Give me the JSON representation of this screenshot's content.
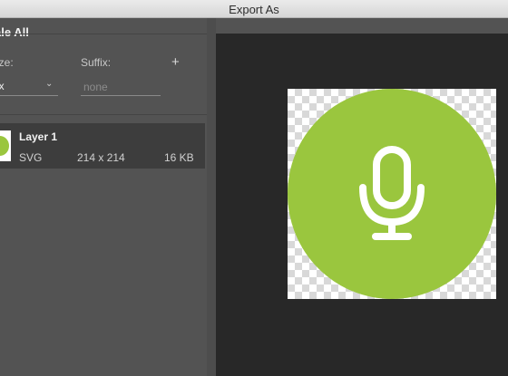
{
  "window": {
    "title": "Export As"
  },
  "left_panel": {
    "scale_all_label": "ale All",
    "size_label": "ize:",
    "suffix_label": "Suffix:",
    "add_button": "+",
    "size_value": "lx",
    "suffix_placeholder": "none"
  },
  "layer": {
    "name": "Layer 1",
    "format": "SVG",
    "dimensions": "214 x 214",
    "file_size": "16 KB"
  },
  "preview": {
    "icon": "microphone-icon",
    "accent_color": "#9ac63e"
  }
}
